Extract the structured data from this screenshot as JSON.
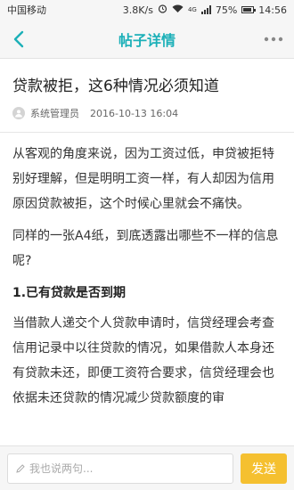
{
  "status_bar": {
    "carrier": "中国移动",
    "speed": "3.8K/s",
    "network": "4G",
    "battery": "75%",
    "battery_level": 0.75,
    "time": "14:56"
  },
  "nav": {
    "title": "帖子详情",
    "accent_color": "#1cb0b8"
  },
  "post": {
    "title": "贷款被拒，这6种情况必须知道",
    "author": "系统管理员",
    "date": "2016-10-13 16:04",
    "paragraphs": [
      "从客观的角度来说，因为工资过低，申贷被拒特别好理解，但是明明工资一样，有人却因为信用原因贷款被拒，这个时候心里就会不痛快。",
      "同样的一张A4纸，到底透露出哪些不一样的信息呢?"
    ],
    "section_heading": "1.已有贷款是否到期",
    "section_body": "当借款人递交个人贷款申请时，信贷经理会考查信用记录中以往贷款的情况，如果借款人本身还有贷款未还，即便工资符合要求，信贷经理会也依据未还贷款的情况减少贷款额度的审"
  },
  "comment_bar": {
    "placeholder": "我也说两句...",
    "send_label": "发送",
    "send_color": "#f5c030"
  }
}
